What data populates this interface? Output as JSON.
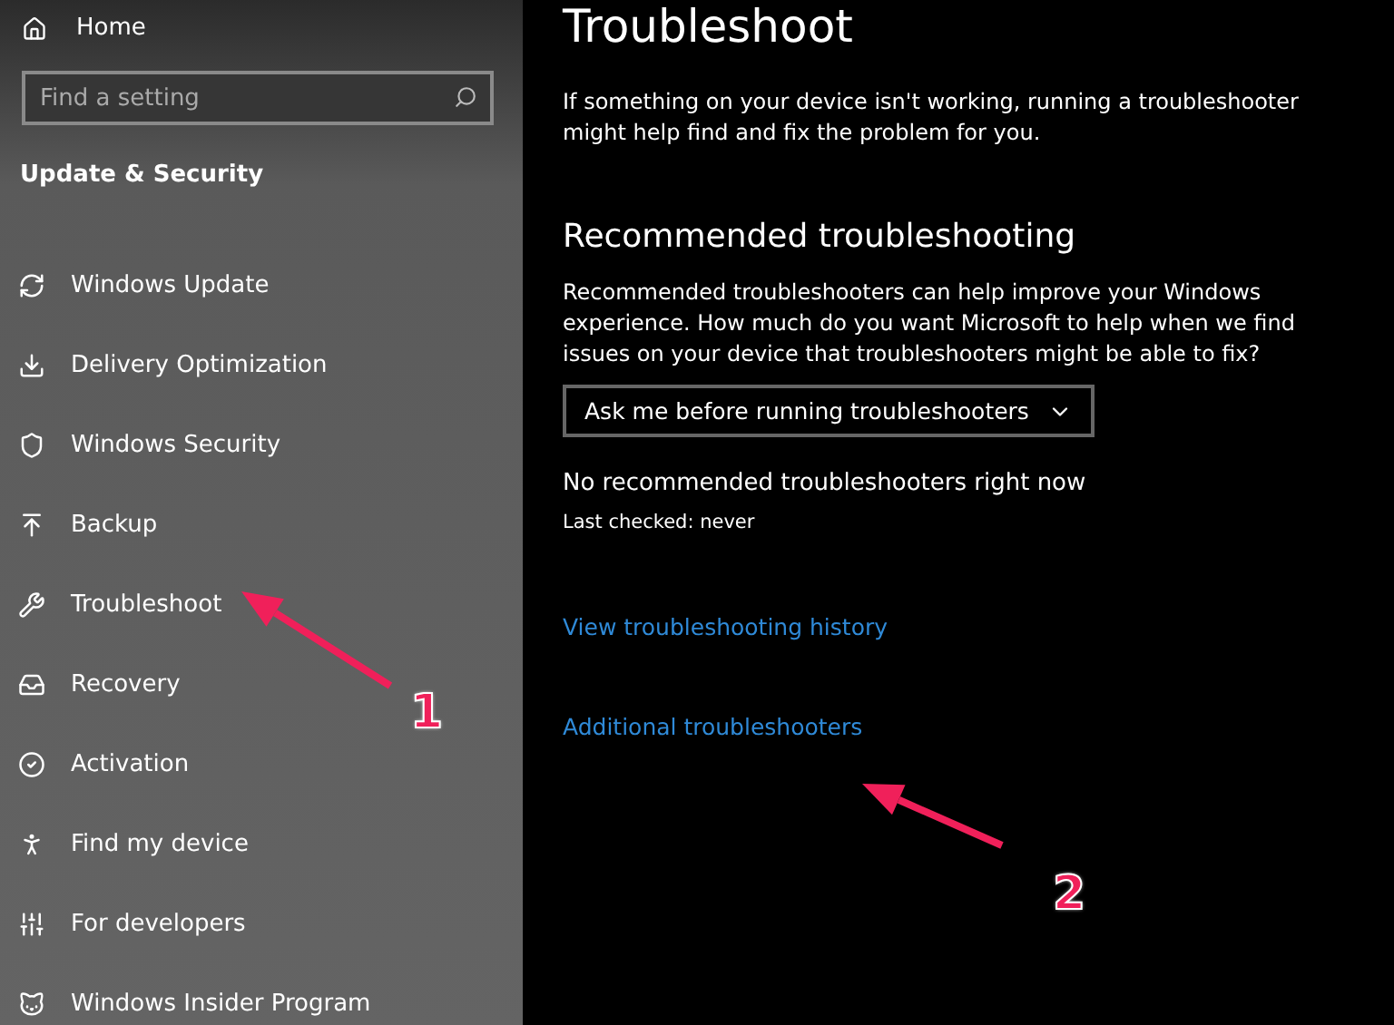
{
  "sidebar": {
    "home": "Home",
    "search": {
      "placeholder": "Find a setting"
    },
    "section": "Update & Security",
    "items": [
      {
        "label": "Windows Update",
        "kind": "sync"
      },
      {
        "label": "Delivery Optimization",
        "kind": "delivery"
      },
      {
        "label": "Windows Security",
        "kind": "shield"
      },
      {
        "label": "Backup",
        "kind": "backup"
      },
      {
        "label": "Troubleshoot",
        "kind": "wrench"
      },
      {
        "label": "Recovery",
        "kind": "recovery"
      },
      {
        "label": "Activation",
        "kind": "check"
      },
      {
        "label": "Find my device",
        "kind": "person"
      },
      {
        "label": "For developers",
        "kind": "tools"
      },
      {
        "label": "Windows Insider Program",
        "kind": "cat"
      }
    ]
  },
  "main": {
    "title": "Troubleshoot",
    "intro": "If something on your device isn't working, running a troubleshooter might help find and fix the problem for you.",
    "section_title": "Recommended troubleshooting",
    "section_text": "Recommended troubleshooters can help improve your Windows experience. How much do you want Microsoft to help when we find issues on your device that troubleshooters might be able to fix?",
    "dropdown": "Ask me before running troubleshooters",
    "status": "No recommended troubleshooters right now",
    "last_checked": "Last checked: never",
    "links": [
      "View troubleshooting history",
      "Additional troubleshooters"
    ]
  },
  "annotations": [
    {
      "number": "1"
    },
    {
      "number": "2"
    }
  ]
}
